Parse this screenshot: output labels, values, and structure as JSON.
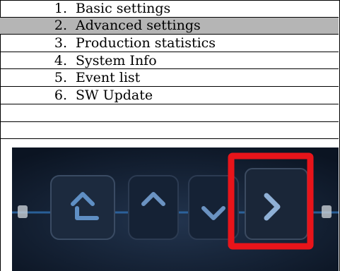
{
  "menu": {
    "items": [
      {
        "num": "1.",
        "label": "Basic settings",
        "selected": false
      },
      {
        "num": "2.",
        "label": "Advanced settings",
        "selected": true
      },
      {
        "num": "3.",
        "label": "Production statistics",
        "selected": false
      },
      {
        "num": "4.",
        "label": "System Info",
        "selected": false
      },
      {
        "num": "5.",
        "label": "Event list",
        "selected": false
      },
      {
        "num": "6.",
        "label": "SW Update",
        "selected": false
      }
    ]
  },
  "keypad": {
    "buttons": [
      {
        "name": "home-up-button",
        "icon": "home-up-icon"
      },
      {
        "name": "up-button",
        "icon": "chevron-up-icon"
      },
      {
        "name": "down-button",
        "icon": "chevron-down-icon"
      },
      {
        "name": "right-button",
        "icon": "chevron-right-icon",
        "highlighted": true
      }
    ],
    "highlight_color": "#e8141a"
  }
}
